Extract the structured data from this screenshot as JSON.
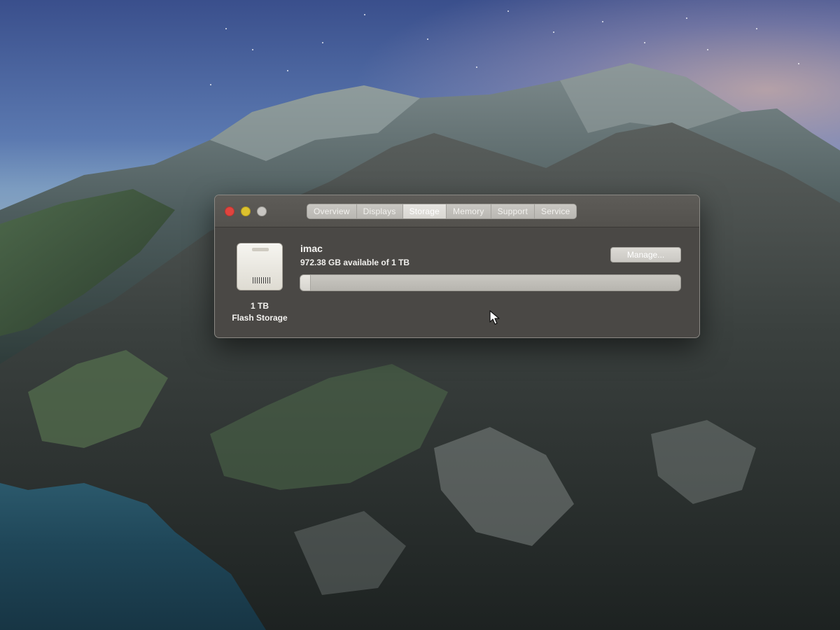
{
  "window": {
    "tabs": [
      {
        "label": "Overview"
      },
      {
        "label": "Displays"
      },
      {
        "label": "Storage",
        "active": true
      },
      {
        "label": "Memory"
      },
      {
        "label": "Support"
      },
      {
        "label": "Service"
      }
    ]
  },
  "storage": {
    "drive_name": "imac",
    "availability": "972.38 GB available of 1 TB",
    "capacity_label": "1 TB",
    "type_label": "Flash Storage",
    "manage_label": "Manage...",
    "used_fraction": 0.028
  },
  "colors": {
    "close": "#e0443e",
    "minimize": "#dcc12e",
    "zoom": "#c8c6c2",
    "window_bg": "#4a4845"
  },
  "icons": [
    "close-icon",
    "minimize-icon",
    "zoom-icon",
    "flash-drive-icon",
    "mouse-pointer-icon"
  ]
}
